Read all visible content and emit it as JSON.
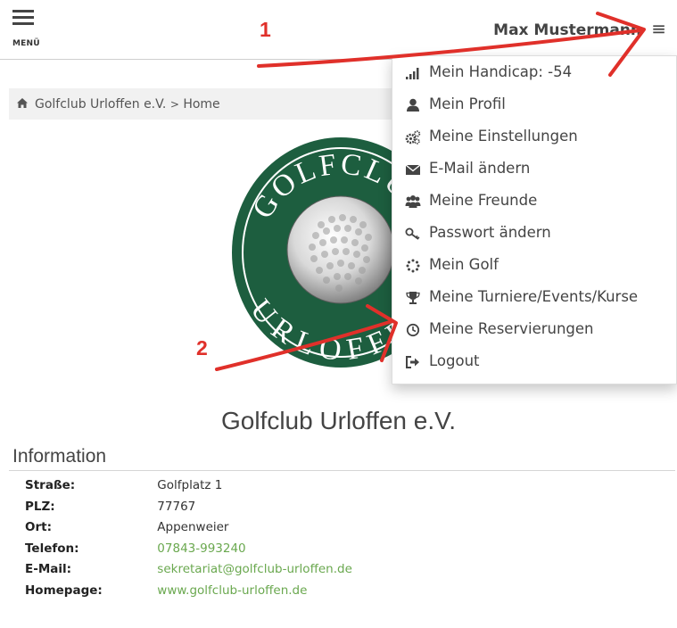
{
  "header": {
    "menu_label": "MENÜ",
    "user_name": "Max Mustermann"
  },
  "breadcrumb": {
    "club": "Golfclub Urloffen e.V.",
    "separator": ">",
    "current": "Home"
  },
  "dropdown": {
    "items": [
      {
        "label": "Mein Handicap: -54",
        "icon": "signal-bars-icon"
      },
      {
        "label": "Mein Profil",
        "icon": "user-icon"
      },
      {
        "label": "Meine Einstellungen",
        "icon": "gears-icon"
      },
      {
        "label": "E-Mail ändern",
        "icon": "envelope-icon"
      },
      {
        "label": "Meine Freunde",
        "icon": "users-icon"
      },
      {
        "label": "Passwort ändern",
        "icon": "key-icon"
      },
      {
        "label": "Mein Golf",
        "icon": "spinner-icon"
      },
      {
        "label": "Meine Turniere/Events/Kurse",
        "icon": "trophy-icon"
      },
      {
        "label": "Meine Reservierungen",
        "icon": "clock-icon"
      },
      {
        "label": "Logout",
        "icon": "sign-out-icon"
      }
    ]
  },
  "logo": {
    "top_text": "GOLFCLUB",
    "bottom_text": "URLOFFEN",
    "color_green": "#1d5e3f"
  },
  "club": {
    "title": "Golfclub Urloffen e.V."
  },
  "info": {
    "heading": "Information",
    "rows": [
      {
        "label": "Straße:",
        "value": "Golfplatz 1"
      },
      {
        "label": "PLZ:",
        "value": "77767"
      },
      {
        "label": "Ort:",
        "value": "Appenweier"
      },
      {
        "label": "Telefon:",
        "value": "07843-993240"
      },
      {
        "label": "E-Mail:",
        "value": "sekretariat@golfclub-urloffen.de"
      },
      {
        "label": "Homepage:",
        "value": "www.golfclub-urloffen.de"
      }
    ]
  },
  "annotations": {
    "marker_1": "1",
    "marker_2": "2",
    "arrow_color": "#e0302a"
  },
  "colors": {
    "link_green": "#6aa84f",
    "text": "#444444"
  }
}
